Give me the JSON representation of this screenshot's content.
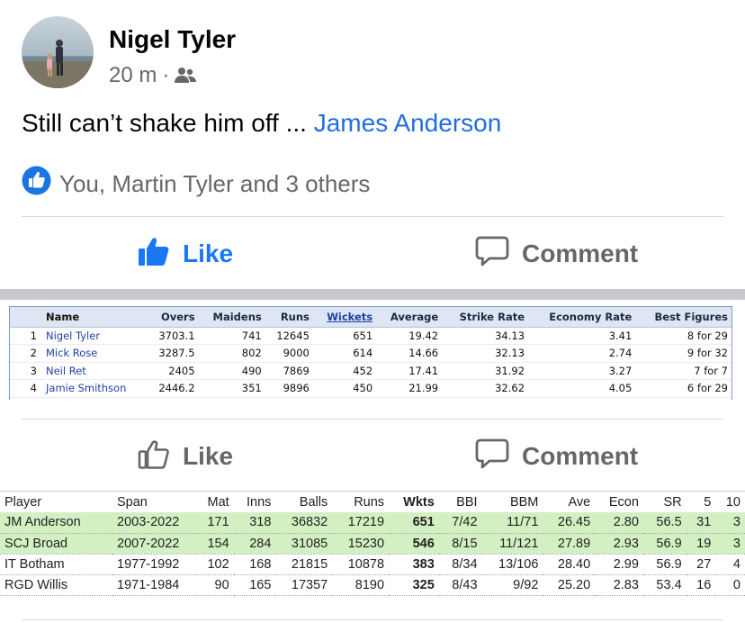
{
  "post": {
    "author": "Nigel Tyler",
    "time": "20 m",
    "separator": "·",
    "audience_icon": "friends-icon",
    "text": "Still can’t shake him off ... ",
    "mention": "James Anderson",
    "reactions_text": "You, Martin Tyler and 3 others",
    "like_label": "Like",
    "comment_label": "Comment",
    "colors": {
      "mention": "#216fdb",
      "like_active": "#1877f2",
      "secondary": "#65676b"
    }
  },
  "table1": {
    "headers": [
      "Name",
      "Overs",
      "Maidens",
      "Runs",
      "Wickets",
      "Average",
      "Strike Rate",
      "Economy Rate",
      "Best Figures"
    ],
    "rows": [
      [
        "1",
        "Nigel Tyler",
        "3703.1",
        "741",
        "12645",
        "651",
        "19.42",
        "34.13",
        "3.41",
        "8 for 29"
      ],
      [
        "2",
        "Mick Rose",
        "3287.5",
        "802",
        "9000",
        "614",
        "14.66",
        "32.13",
        "2.74",
        "9 for 32"
      ],
      [
        "3",
        "Neil Ret",
        "2405",
        "490",
        "7869",
        "452",
        "17.41",
        "31.92",
        "3.27",
        "7 for 7"
      ],
      [
        "4",
        "Jamie Smithson",
        "2446.2",
        "351",
        "9896",
        "450",
        "21.99",
        "32.62",
        "4.05",
        "6 for 29"
      ]
    ]
  },
  "second_actions": {
    "like_label": "Like",
    "comment_label": "Comment"
  },
  "table2": {
    "headers": [
      "Player",
      "Span",
      "Mat",
      "Inns",
      "Balls",
      "Runs",
      "Wkts",
      "BBI",
      "BBM",
      "Ave",
      "Econ",
      "SR",
      "5",
      "10"
    ],
    "rows": [
      [
        "JM Anderson",
        "2003-2022",
        "171",
        "318",
        "36832",
        "17219",
        "651",
        "7/42",
        "11/71",
        "26.45",
        "2.80",
        "56.5",
        "31",
        "3"
      ],
      [
        "SCJ Broad",
        "2007-2022",
        "154",
        "284",
        "31085",
        "15230",
        "546",
        "8/15",
        "11/121",
        "27.89",
        "2.93",
        "56.9",
        "19",
        "3"
      ],
      [
        "IT Botham",
        "1977-1992",
        "102",
        "168",
        "21815",
        "10878",
        "383",
        "8/34",
        "13/106",
        "28.40",
        "2.99",
        "56.9",
        "27",
        "4"
      ],
      [
        "RGD Willis",
        "1971-1984",
        "90",
        "165",
        "17357",
        "8190",
        "325",
        "8/43",
        "9/92",
        "25.20",
        "2.83",
        "53.4",
        "16",
        "0"
      ]
    ],
    "highlight_color": "#d3f0c3"
  }
}
